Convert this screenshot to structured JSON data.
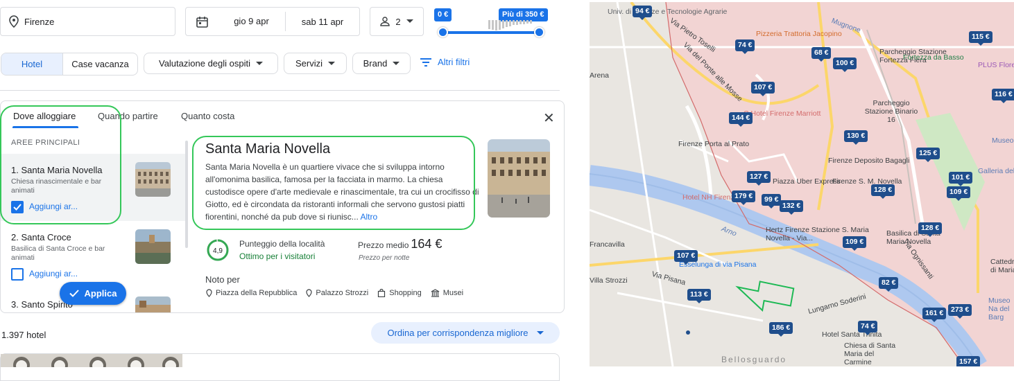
{
  "search": {
    "location": "Firenze",
    "checkin": "gio 9 apr",
    "checkout": "sab 11 apr",
    "guests": "2"
  },
  "price_filter": {
    "min_label": "0 €",
    "max_label": "Più di 350 €"
  },
  "filters": {
    "hotel": "Hotel",
    "case_vacanza": "Case vacanza",
    "valutazione": "Valutazione degli ospiti",
    "servizi": "Servizi",
    "brand": "Brand",
    "altri": "Altri filtri"
  },
  "panel": {
    "tabs": [
      "Dove alloggiare",
      "Quando partire",
      "Quanto costa"
    ],
    "section_title": "AREE PRINCIPALI",
    "areas": [
      {
        "name": "1. Santa Maria Novella",
        "desc": "Chiesa rinascimentale e bar animati",
        "add": "Aggiungi ar...",
        "checked": true
      },
      {
        "name": "2. Santa Croce",
        "desc": "Basilica di Santa Croce e bar animati",
        "add": "Aggiungi ar...",
        "checked": false
      },
      {
        "name": "3. Santo Spirito",
        "desc": "",
        "add": "",
        "checked": false
      }
    ],
    "apply": "Applica",
    "detail": {
      "title": "Santa Maria Novella",
      "text": "Santa Maria Novella è un quartiere vivace che si sviluppa intorno all'omonima basilica, famosa per la facciata in marmo. La chiesa custodisce opere d'arte medievale e rinascimentale, tra cui un crocifisso di Giotto, ed è circondata da ristoranti informali che servono gustosi piatti fiorentini, nonché da pub dove si riunisc...",
      "more": "Altro",
      "score": "4,9",
      "score_value": 4.9,
      "score_label": "Punteggio della località",
      "score_desc": "Ottimo per i visitatori",
      "price_label": "Prezzo medio",
      "price_value": "164 €",
      "price_note": "Prezzo per notte",
      "noto_title": "Noto per",
      "noto": [
        {
          "label": "Piazza della Repubblica",
          "icon": "location-pin-icon"
        },
        {
          "label": "Palazzo Strozzi",
          "icon": "location-pin-icon"
        },
        {
          "label": "Shopping",
          "icon": "shopping-bag-icon"
        },
        {
          "label": "Musei",
          "icon": "museum-icon"
        }
      ]
    }
  },
  "results": {
    "count": "1.397 hotel",
    "sort": "Ordina per corrispondenza migliore"
  },
  "map": {
    "labels": [
      "Univ. di Scienze e Tecnologie Agrarie",
      "Via Pietro Toselli",
      "Pizzeria Trattoria Jacopino",
      "Mugnone",
      "Via del Ponte alle Mosse",
      "Parcheggio Stazione Fortezza Fiera",
      "Fortezza da Basso",
      "PLUS Flore",
      "Parcheggio Stazione Binario 16",
      "C Hotel Firenze Marriott",
      "Firenze Porta al Prato",
      "Firenze Deposito Bagagli",
      "Museo",
      "Galleria del",
      "Hotel NH Firenze",
      "Piazza Uber Express",
      "Firenze S. M. Novella",
      "Basilica di Santa Maria Novella",
      "Arno",
      "Hertz Firenze Stazione S. Maria Novella - Via...",
      "Esselunga di via Pisana",
      "Via Pisana",
      "Villa Strozzi",
      "Lungarno Soderini",
      "Hotel Santa Trinita",
      "Chiesa di Santa Maria del Carmine",
      "Cattedra di Maria",
      "Museo Na del Barg",
      "Bellosguardo",
      "Arena",
      "Francavilla",
      "Via Ognissanti"
    ],
    "prices": [
      "94 €",
      "74 €",
      "68 €",
      "115 €",
      "100 €",
      "107 €",
      "116 €",
      "144 €",
      "130 €",
      "125 €",
      "127 €",
      "101 €",
      "128 €",
      "109 €",
      "179 €",
      "99 €",
      "132 €",
      "128 €",
      "109 €",
      "107 €",
      "82 €",
      "113 €",
      "161 €",
      "273 €",
      "186 €",
      "74 €",
      "157 €"
    ]
  },
  "colors": {
    "accent": "#1a73e8",
    "marker": "#1f4e8c",
    "score_green": "#188038",
    "highlight": "#34c759"
  }
}
